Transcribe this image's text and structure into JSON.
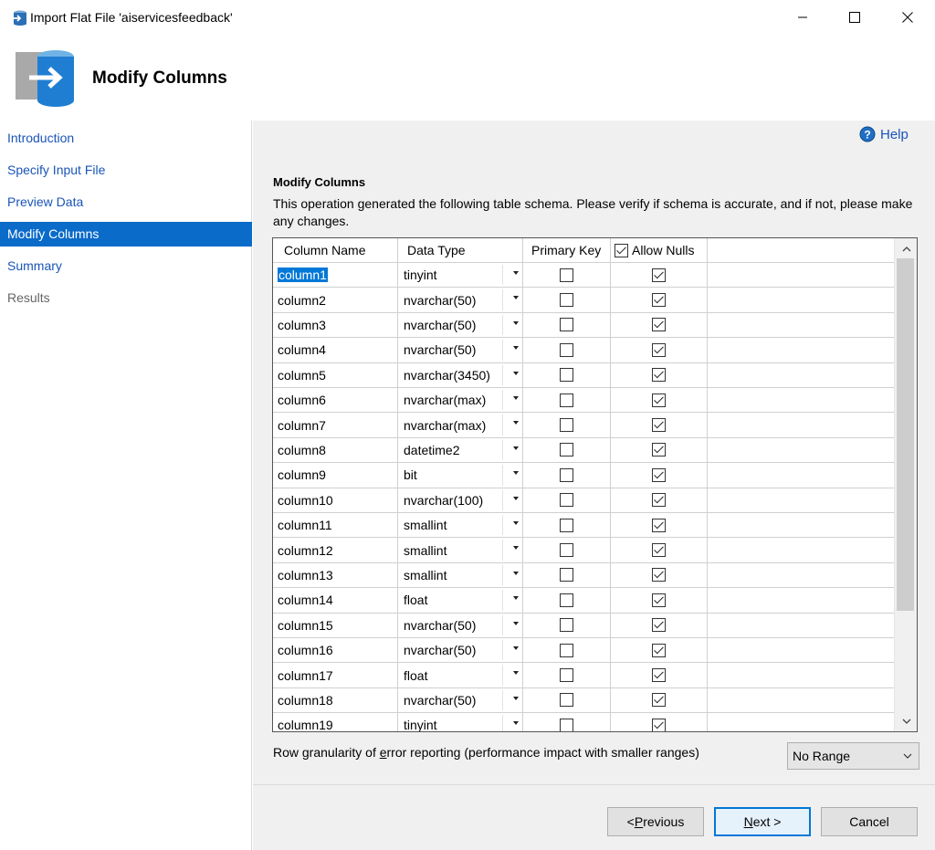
{
  "window": {
    "title": "Import Flat File 'aiservicesfeedback'"
  },
  "header": {
    "title": "Modify Columns"
  },
  "sidebar": {
    "items": [
      {
        "label": "Introduction",
        "state": "link"
      },
      {
        "label": "Specify Input File",
        "state": "link"
      },
      {
        "label": "Preview Data",
        "state": "link"
      },
      {
        "label": "Modify Columns",
        "state": "active"
      },
      {
        "label": "Summary",
        "state": "link"
      },
      {
        "label": "Results",
        "state": "disabled"
      }
    ]
  },
  "help": {
    "label": "Help"
  },
  "section": {
    "title": "Modify Columns",
    "description": "This operation generated the following table schema. Please verify if schema is accurate, and if not, please make any changes."
  },
  "grid": {
    "headers": {
      "name": "Column Name",
      "type": "Data Type",
      "pk": "Primary Key",
      "nulls": "Allow Nulls"
    },
    "allow_nulls_header_checked": true,
    "rows": [
      {
        "name": "column1",
        "type": "tinyint",
        "pk": false,
        "nulls": true,
        "selected": true
      },
      {
        "name": "column2",
        "type": "nvarchar(50)",
        "pk": false,
        "nulls": true
      },
      {
        "name": "column3",
        "type": "nvarchar(50)",
        "pk": false,
        "nulls": true
      },
      {
        "name": "column4",
        "type": "nvarchar(50)",
        "pk": false,
        "nulls": true
      },
      {
        "name": "column5",
        "type": "nvarchar(3450)",
        "pk": false,
        "nulls": true
      },
      {
        "name": "column6",
        "type": "nvarchar(max)",
        "pk": false,
        "nulls": true
      },
      {
        "name": "column7",
        "type": "nvarchar(max)",
        "pk": false,
        "nulls": true
      },
      {
        "name": "column8",
        "type": "datetime2",
        "pk": false,
        "nulls": true
      },
      {
        "name": "column9",
        "type": "bit",
        "pk": false,
        "nulls": true
      },
      {
        "name": "column10",
        "type": "nvarchar(100)",
        "pk": false,
        "nulls": true
      },
      {
        "name": "column11",
        "type": "smallint",
        "pk": false,
        "nulls": true
      },
      {
        "name": "column12",
        "type": "smallint",
        "pk": false,
        "nulls": true
      },
      {
        "name": "column13",
        "type": "smallint",
        "pk": false,
        "nulls": true
      },
      {
        "name": "column14",
        "type": "float",
        "pk": false,
        "nulls": true
      },
      {
        "name": "column15",
        "type": "nvarchar(50)",
        "pk": false,
        "nulls": true
      },
      {
        "name": "column16",
        "type": "nvarchar(50)",
        "pk": false,
        "nulls": true
      },
      {
        "name": "column17",
        "type": "float",
        "pk": false,
        "nulls": true
      },
      {
        "name": "column18",
        "type": "nvarchar(50)",
        "pk": false,
        "nulls": true
      },
      {
        "name": "column19",
        "type": "tinyint",
        "pk": false,
        "nulls": true
      }
    ]
  },
  "granularity": {
    "label_pre": "Row granularity of ",
    "label_key": "e",
    "label_post": "rror reporting (performance impact with smaller ranges)",
    "selected": "No Range"
  },
  "buttons": {
    "prev_pre": "< ",
    "prev_key": "P",
    "prev_post": "revious",
    "next_key": "N",
    "next_post": "ext >",
    "cancel": "Cancel"
  },
  "colors": {
    "accent": "#0a6bc9",
    "link": "#1a55b8",
    "selection": "#0078d7",
    "panel": "#f0f0f0"
  }
}
